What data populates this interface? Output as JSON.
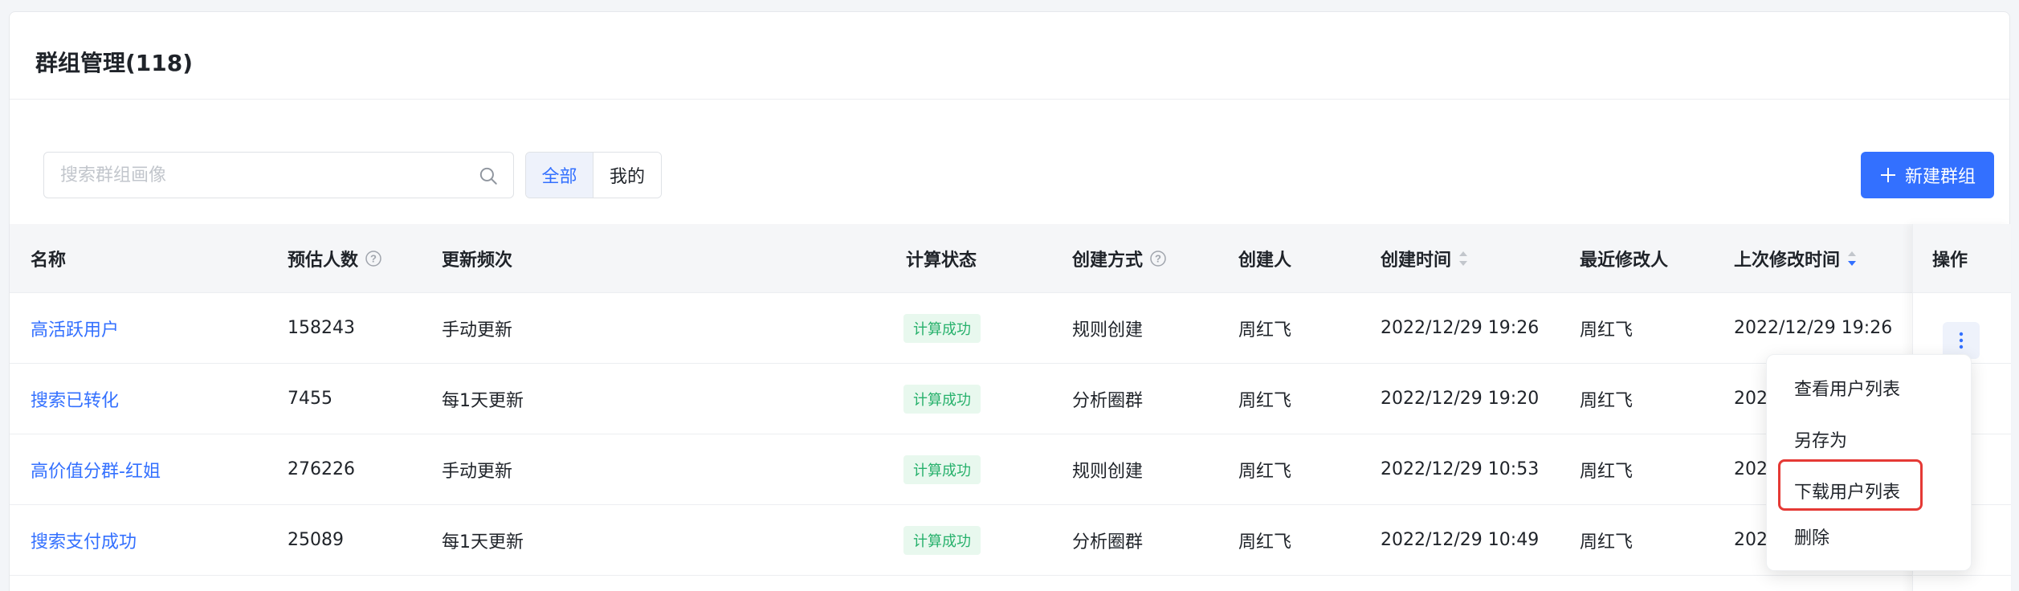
{
  "page": {
    "title": "群组管理(118)"
  },
  "toolbar": {
    "search_placeholder": "搜索群组画像",
    "filters": [
      "全部",
      "我的"
    ],
    "active_filter": "全部",
    "new_button_label": "新建群组"
  },
  "table": {
    "columns": {
      "name": "名称",
      "estimated": "预估人数",
      "frequency": "更新频次",
      "status": "计算状态",
      "method": "创建方式",
      "creator": "创建人",
      "created_at": "创建时间",
      "modifier": "最近修改人",
      "modified_at": "上次修改时间",
      "actions": "操作"
    },
    "rows": [
      {
        "name": "高活跃用户",
        "estimated": "158243",
        "frequency": "手动更新",
        "status": "计算成功",
        "method": "规则创建",
        "creator": "周红飞",
        "created_at": "2022/12/29 19:26",
        "modifier": "周红飞",
        "modified_at": "2022/12/29 19:26"
      },
      {
        "name": "搜索已转化",
        "estimated": "7455",
        "frequency": "每1天更新",
        "status": "计算成功",
        "method": "分析圈群",
        "creator": "周红飞",
        "created_at": "2022/12/29 19:20",
        "modifier": "周红飞",
        "modified_at": "202"
      },
      {
        "name": "高价值分群-红姐",
        "estimated": "276226",
        "frequency": "手动更新",
        "status": "计算成功",
        "method": "规则创建",
        "creator": "周红飞",
        "created_at": "2022/12/29 10:53",
        "modifier": "周红飞",
        "modified_at": "202"
      },
      {
        "name": "搜索支付成功",
        "estimated": "25089",
        "frequency": "每1天更新",
        "status": "计算成功",
        "method": "分析圈群",
        "creator": "周红飞",
        "created_at": "2022/12/29 10:49",
        "modifier": "周红飞",
        "modified_at": "202"
      }
    ]
  },
  "dropdown_menu": {
    "items": [
      "查看用户列表",
      "另存为",
      "下载用户列表",
      "删除"
    ],
    "highlighted_item": "下载用户列表"
  },
  "colors": {
    "accent": "#3370ff",
    "success_text": "#27b16c",
    "success_bg": "#e8f8ee",
    "highlight_border": "#e53935"
  },
  "icons": [
    "search-icon",
    "plus-icon",
    "help-icon",
    "sort-icon",
    "more-vertical-icon"
  ]
}
